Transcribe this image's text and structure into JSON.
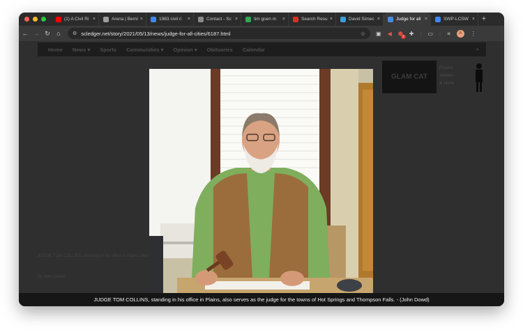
{
  "browser": {
    "tabs": [
      {
        "title": "(1) A Civil Ri",
        "favicon": "youtube-icon",
        "color": "#ff0000"
      },
      {
        "title": "Arena | Berni",
        "favicon": "arena-icon",
        "color": "#9e9e9e"
      },
      {
        "title": "1983 civil ri",
        "favicon": "google-icon",
        "color": "#4285f4"
      },
      {
        "title": "Contact - Sc",
        "favicon": "scale-icon",
        "color": "#8a8a8a"
      },
      {
        "title": "tim goen m",
        "favicon": "google-icon",
        "color": "#34a853"
      },
      {
        "title": "Search Resu",
        "favicon": "search-result-icon",
        "color": "#d93025"
      },
      {
        "title": "David Simec",
        "favicon": "photo-icon",
        "color": "#3aa0d8"
      },
      {
        "title": "Judge for all",
        "favicon": "newspaper-icon",
        "color": "#4a8bdf"
      },
      {
        "title": "SWP-LCSW",
        "favicon": "google-icon",
        "color": "#4285f4"
      }
    ],
    "url": "scledger.net/story/2021/05/13/news/judge-for-all-cities/6187.html",
    "profile_initial": "A",
    "notification_count": "3"
  },
  "site": {
    "nav": [
      "Home",
      "News ▾",
      "Sports",
      "Communities ▾",
      "Opinion ▾",
      "Obituaries",
      "Calendar"
    ],
    "ad_brand": "GLAM CAT",
    "ad_lines": [
      "Round",
      "Jewels",
      "& More"
    ],
    "dim_caption": "JUDGE TOM COLLINS, standing in his office in Plains, also serves",
    "dim_byline": "By John Dowd"
  },
  "lightbox": {
    "caption": "JUDGE TOM COLLINS, standing in his office in Plains, also serves as the judge for the towns of Hot Springs and Thompson Falls. - (John Dowd)"
  }
}
